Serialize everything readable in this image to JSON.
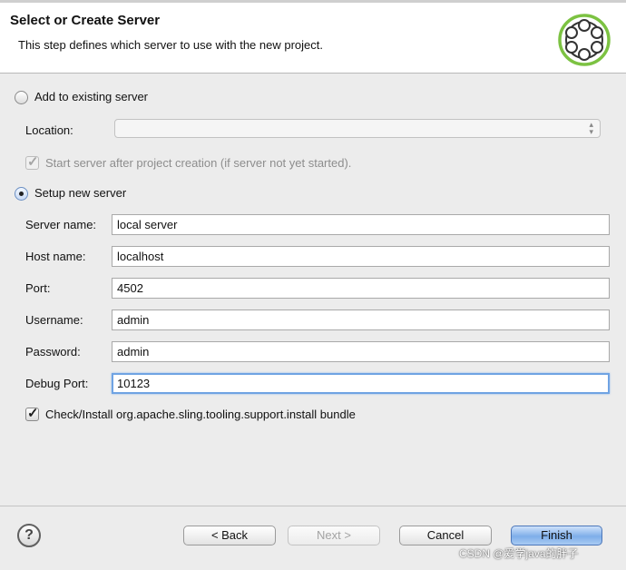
{
  "header": {
    "title": "Select or Create Server",
    "subtitle": "This step defines which server to use with the new project."
  },
  "existing_server": {
    "radio_label": "Add to existing server",
    "selected": false,
    "location_label": "Location:",
    "location_value": "",
    "start_server_label": "Start server after project creation (if server not yet started).",
    "start_server_checked": true
  },
  "new_server": {
    "radio_label": "Setup new server",
    "selected": true,
    "fields": {
      "server_name": {
        "label": "Server name:",
        "value": "local server"
      },
      "host_name": {
        "label": "Host name:",
        "value": "localhost"
      },
      "port": {
        "label": "Port:",
        "value": "4502"
      },
      "username": {
        "label": "Username:",
        "value": "admin"
      },
      "password": {
        "label": "Password:",
        "value": "admin"
      },
      "debug_port": {
        "label": "Debug Port:",
        "value": "10123"
      }
    },
    "install_bundle_label": "Check/Install org.apache.sling.tooling.support.install bundle",
    "install_bundle_checked": true
  },
  "footer": {
    "help_glyph": "?",
    "back_label": "< Back",
    "next_label": "Next >",
    "cancel_label": "Cancel",
    "finish_label": "Finish"
  },
  "watermark": "CSDN @爱学java的胖子",
  "colors": {
    "logo_green": "#7cc242",
    "focus_blue": "#6fa3e3",
    "default_button_blue": "#7eaee9"
  },
  "icons": {
    "logo": "server-wizard-logo-icon",
    "help": "help-icon",
    "select_arrows": "updown-arrows-icon",
    "check": "checkmark-icon"
  }
}
